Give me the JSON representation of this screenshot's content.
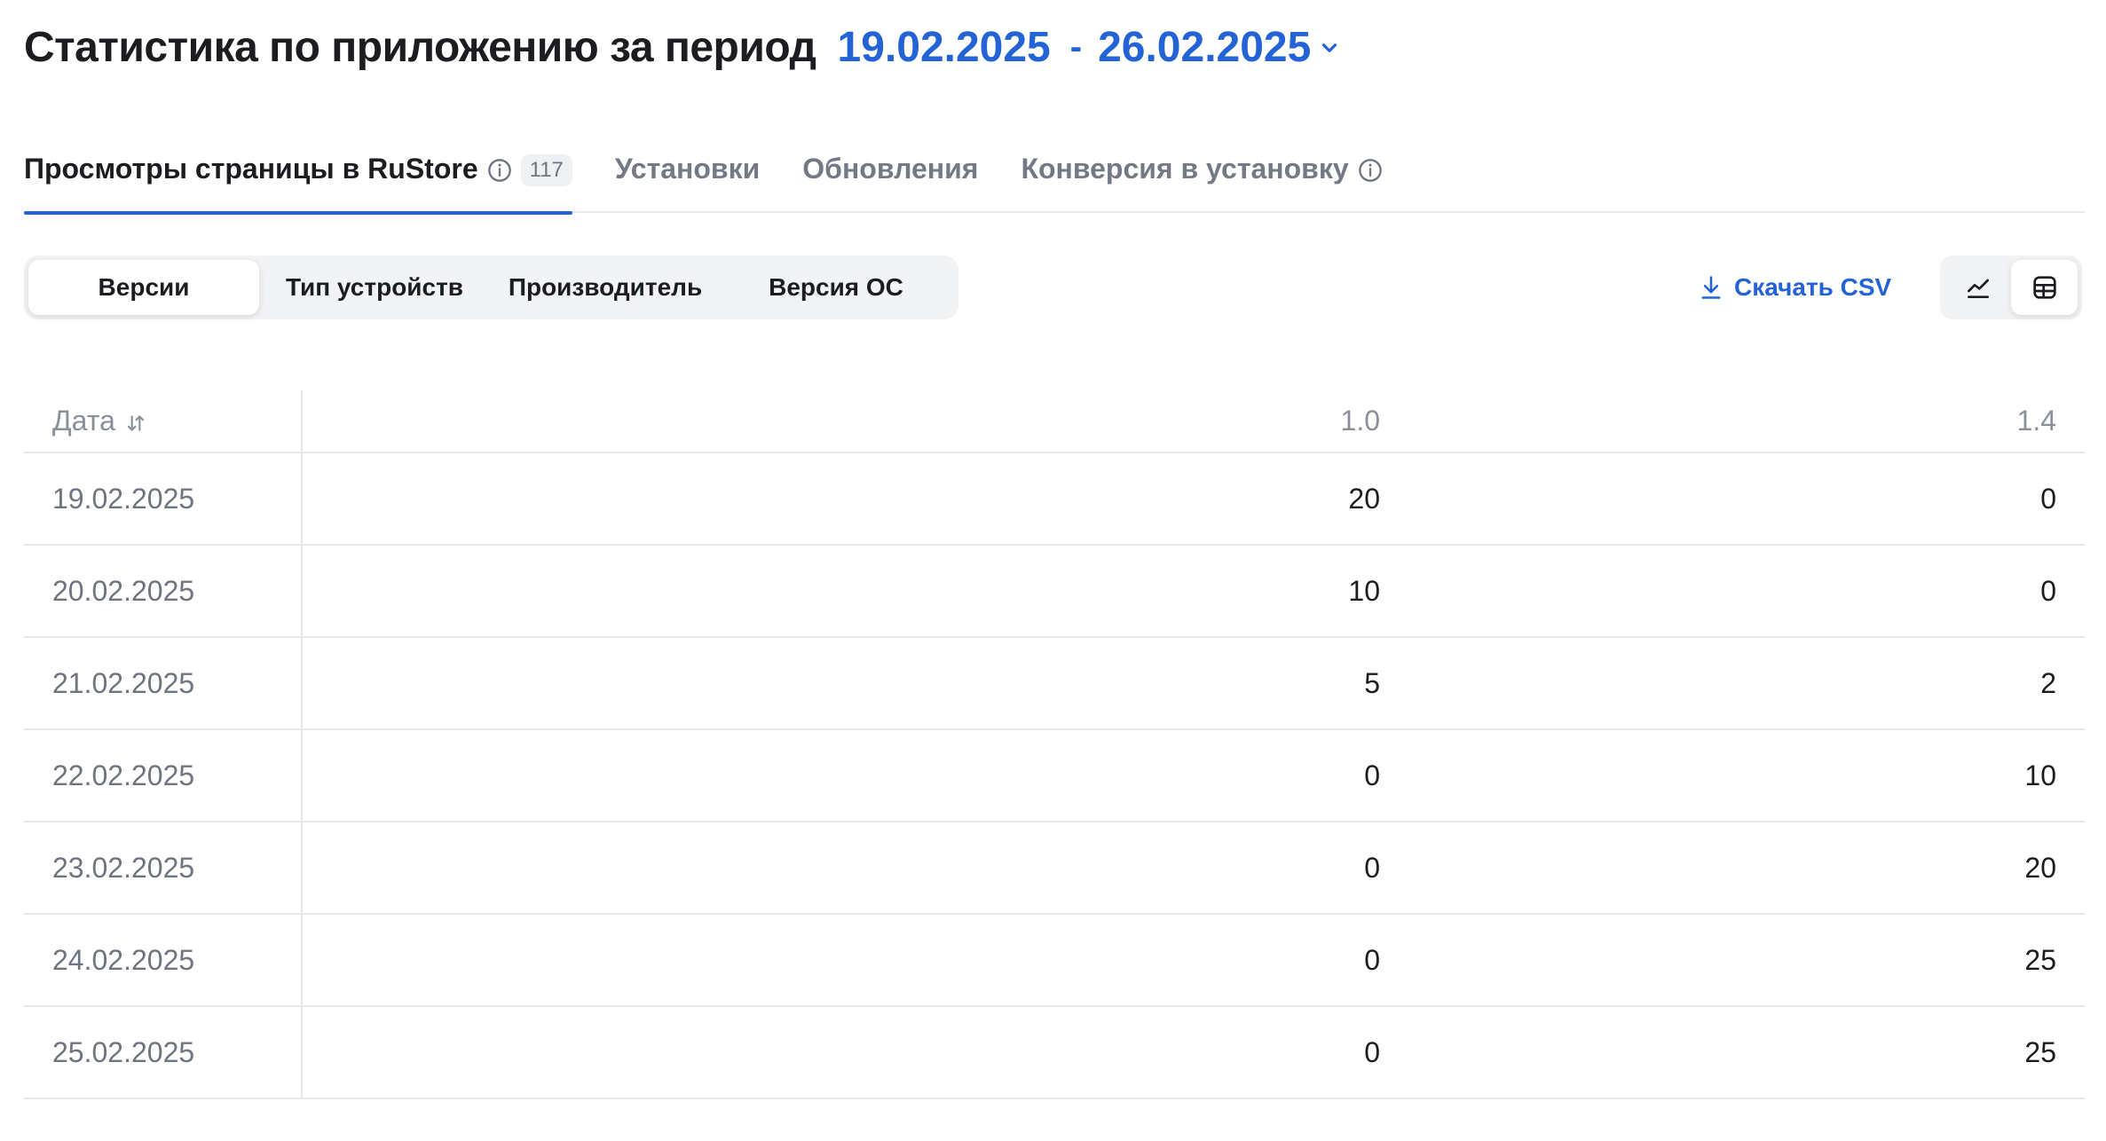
{
  "header": {
    "title": "Статистика по приложению за период",
    "period_start": "19.02.2025",
    "period_separator": "-",
    "period_end": "26.02.2025"
  },
  "tabs": [
    {
      "label": "Просмотры страницы в RuStore",
      "badge": "117",
      "active": true,
      "info": true
    },
    {
      "label": "Установки",
      "active": false
    },
    {
      "label": "Обновления",
      "active": false
    },
    {
      "label": "Конверсия в установку",
      "active": false,
      "info": true
    }
  ],
  "segments": [
    {
      "label": "Версии",
      "active": true
    },
    {
      "label": "Тип устройств",
      "active": false
    },
    {
      "label": "Производитель",
      "active": false
    },
    {
      "label": "Версия ОС",
      "active": false
    }
  ],
  "toolbar": {
    "download_csv_label": "Скачать CSV",
    "view_chart_icon": "line-chart-icon",
    "view_table_icon": "table-icon",
    "active_view": "table"
  },
  "table": {
    "columns": [
      "Дата",
      "1.0",
      "1.4"
    ],
    "rows": [
      [
        "19.02.2025",
        "20",
        "0"
      ],
      [
        "20.02.2025",
        "10",
        "0"
      ],
      [
        "21.02.2025",
        "5",
        "2"
      ],
      [
        "22.02.2025",
        "0",
        "10"
      ],
      [
        "23.02.2025",
        "0",
        "20"
      ],
      [
        "24.02.2025",
        "0",
        "25"
      ],
      [
        "25.02.2025",
        "0",
        "25"
      ]
    ]
  },
  "colors": {
    "accent": "#2463d6",
    "text": "#1b1d21",
    "muted": "#747a85",
    "divider": "#e6e8ec",
    "segment_bg": "#f2f3f5"
  }
}
